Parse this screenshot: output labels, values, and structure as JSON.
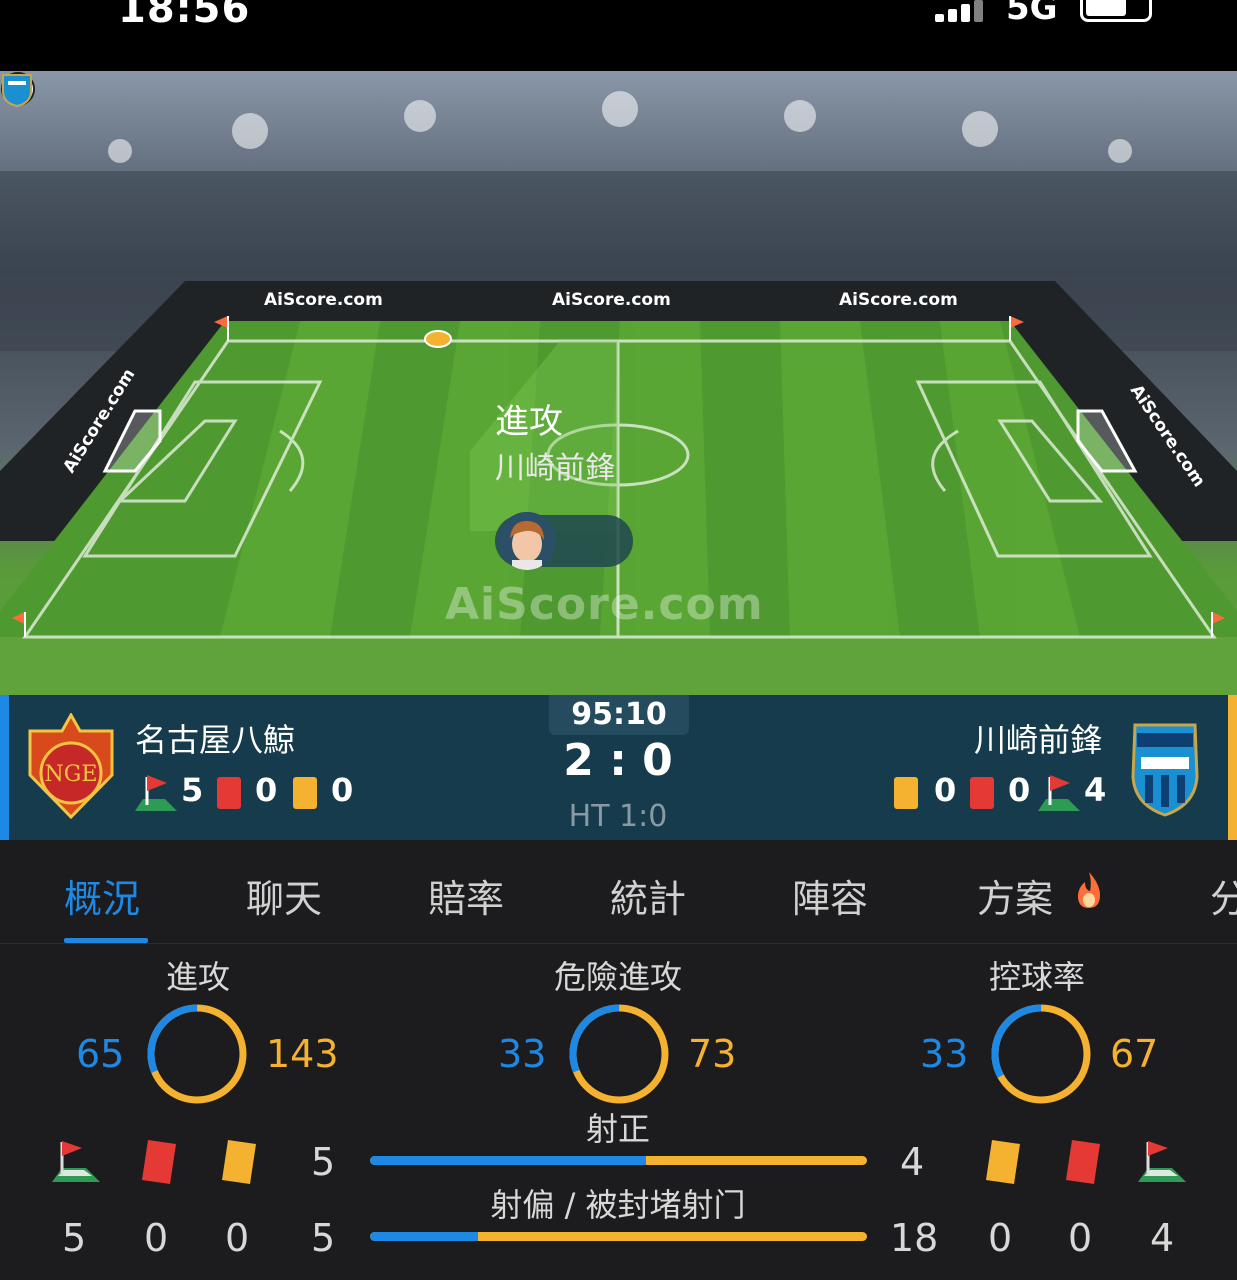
{
  "status_bar": {
    "time": "18:56",
    "network": "5G"
  },
  "pitch": {
    "ads": [
      "AiScore.com",
      "AiScore.com",
      "AiScore.com"
    ],
    "side_ads": [
      "AiScore.com",
      "AiScore.com"
    ],
    "watermark": "AiScore.com",
    "event_title": "進攻",
    "event_team": "川崎前鋒"
  },
  "match": {
    "time": "95:10",
    "score": "2 : 0",
    "half_time": "HT 1:0",
    "home": {
      "name": "名古屋八鯨",
      "corners": "5",
      "red": "0",
      "yellow": "0"
    },
    "away": {
      "name": "川崎前鋒",
      "yellow": "0",
      "red": "0",
      "corners": "4"
    }
  },
  "tabs": [
    "概況",
    "聊天",
    "賠率",
    "統計",
    "陣容",
    "方案",
    "分"
  ],
  "overview": {
    "gauges": [
      {
        "label": "進攻",
        "home": "65",
        "away": "143",
        "home_fraction": 0.3125
      },
      {
        "label": "危險進攻",
        "home": "33",
        "away": "73",
        "home_fraction": 0.311
      },
      {
        "label": "控球率",
        "home": "33",
        "away": "67",
        "home_fraction": 0.33
      }
    ],
    "bars": [
      {
        "label": "射正",
        "home": "5",
        "away": "4",
        "home_fraction": 0.556
      },
      {
        "label": "射偏 / 被封堵射门",
        "home": "5",
        "away": "18",
        "home_fraction": 0.217
      }
    ],
    "home_counts": {
      "corners": "5",
      "red": "0",
      "yellow": "0"
    },
    "away_counts": {
      "yellow": "0",
      "red": "0",
      "corners": "4"
    }
  },
  "colors": {
    "home": "#1e88e5",
    "away": "#f5b130",
    "red_card": "#e53935",
    "pitch": "#5fa33a"
  }
}
